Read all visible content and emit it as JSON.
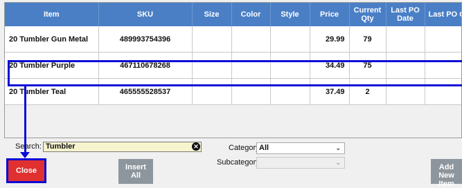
{
  "columns": [
    "Item",
    "SKU",
    "Size",
    "Color",
    "Style",
    "Price",
    "Current Qty",
    "Last PO Date",
    "Last PO Qty"
  ],
  "rows": [
    {
      "item": "20 Tumbler Gun Metal",
      "sku": "489993754396",
      "size": "",
      "color": "",
      "style": "",
      "price": "29.99",
      "qty": "79",
      "last_po_date": "",
      "last_po_qty": ""
    },
    {
      "item": "20 Tumbler Purple",
      "sku": "467110678268",
      "size": "",
      "color": "",
      "style": "",
      "price": "34.49",
      "qty": "75",
      "last_po_date": "",
      "last_po_qty": ""
    },
    {
      "item": "20 Tumbler Teal",
      "sku": "465555528537",
      "size": "",
      "color": "",
      "style": "",
      "price": "37.49",
      "qty": "2",
      "last_po_date": "",
      "last_po_qty": ""
    }
  ],
  "search": {
    "label": "Search:",
    "value": "Tumbler",
    "clear_glyph": "✕"
  },
  "category": {
    "label": "Category",
    "value": "All"
  },
  "subcategory": {
    "label": "Subcategory",
    "value": ""
  },
  "buttons": {
    "close": "Close",
    "insert_all_line1": "Insert",
    "insert_all_line2": "All",
    "add_new_line1": "Add",
    "add_new_line2": "New Item"
  },
  "colors": {
    "header": "#4a7fc6",
    "highlight": "#0b0bd6",
    "close": "#e0302f",
    "grey_button": "#8e969d",
    "search_bg": "#f6f4cf"
  }
}
